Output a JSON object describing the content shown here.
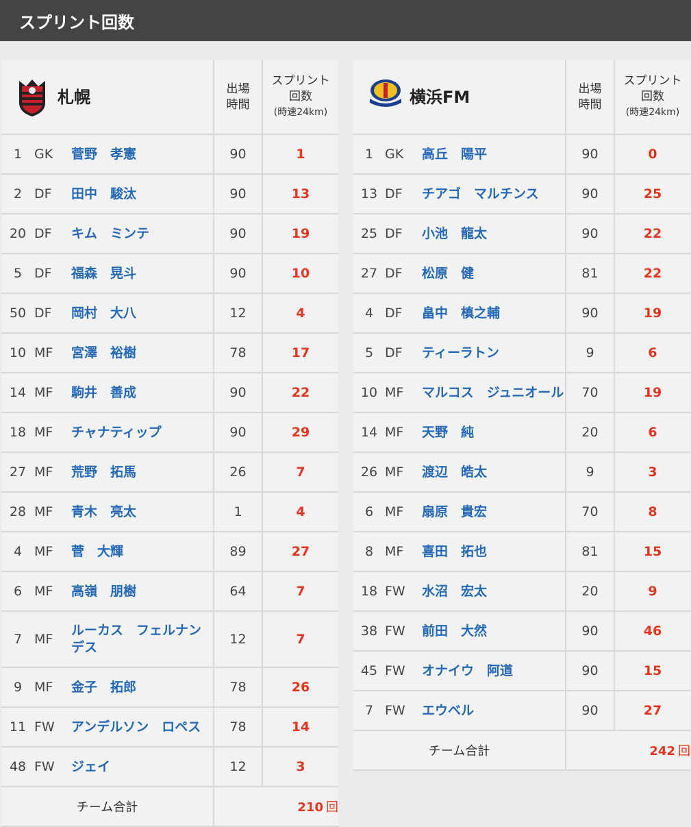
{
  "title": "スプリント回数",
  "columns": {
    "minutes_line1": "出場",
    "minutes_line2": "時間",
    "sprint_line1": "スプリント",
    "sprint_line2": "回数",
    "sprint_line3": "(時速24km)"
  },
  "total_label": "チーム合計",
  "total_unit": "回",
  "colors": {
    "header_bg": "#444444",
    "name": "#2369b8",
    "sprint": "#e8341c"
  },
  "teams": [
    {
      "name": "札幌",
      "emblem": "sapporo-emblem-icon",
      "total": "210",
      "players": [
        {
          "no": "1",
          "pos": "GK",
          "name": "菅野　孝憲",
          "min": "90",
          "sprints": "1"
        },
        {
          "no": "2",
          "pos": "DF",
          "name": "田中　駿汰",
          "min": "90",
          "sprints": "13"
        },
        {
          "no": "20",
          "pos": "DF",
          "name": "キム　ミンテ",
          "min": "90",
          "sprints": "19"
        },
        {
          "no": "5",
          "pos": "DF",
          "name": "福森　晃斗",
          "min": "90",
          "sprints": "10"
        },
        {
          "no": "50",
          "pos": "DF",
          "name": "岡村　大八",
          "min": "12",
          "sprints": "4"
        },
        {
          "no": "10",
          "pos": "MF",
          "name": "宮澤　裕樹",
          "min": "78",
          "sprints": "17"
        },
        {
          "no": "14",
          "pos": "MF",
          "name": "駒井　善成",
          "min": "90",
          "sprints": "22"
        },
        {
          "no": "18",
          "pos": "MF",
          "name": "チャナティップ",
          "min": "90",
          "sprints": "29"
        },
        {
          "no": "27",
          "pos": "MF",
          "name": "荒野　拓馬",
          "min": "26",
          "sprints": "7"
        },
        {
          "no": "28",
          "pos": "MF",
          "name": "青木　亮太",
          "min": "1",
          "sprints": "4"
        },
        {
          "no": "4",
          "pos": "MF",
          "name": "菅　大輝",
          "min": "89",
          "sprints": "27"
        },
        {
          "no": "6",
          "pos": "MF",
          "name": "高嶺　朋樹",
          "min": "64",
          "sprints": "7"
        },
        {
          "no": "7",
          "pos": "MF",
          "name": "ルーカス　フェルナンデス",
          "min": "12",
          "sprints": "7",
          "tall": true
        },
        {
          "no": "9",
          "pos": "MF",
          "name": "金子　拓郎",
          "min": "78",
          "sprints": "26"
        },
        {
          "no": "11",
          "pos": "FW",
          "name": "アンデルソン　ロペス",
          "min": "78",
          "sprints": "14"
        },
        {
          "no": "48",
          "pos": "FW",
          "name": "ジェイ",
          "min": "12",
          "sprints": "3"
        }
      ]
    },
    {
      "name": "横浜FM",
      "emblem": "yokohama-fm-emblem-icon",
      "total": "242",
      "players": [
        {
          "no": "1",
          "pos": "GK",
          "name": "高丘　陽平",
          "min": "90",
          "sprints": "0"
        },
        {
          "no": "13",
          "pos": "DF",
          "name": "チアゴ　マルチンス",
          "min": "90",
          "sprints": "25"
        },
        {
          "no": "25",
          "pos": "DF",
          "name": "小池　龍太",
          "min": "90",
          "sprints": "22"
        },
        {
          "no": "27",
          "pos": "DF",
          "name": "松原　健",
          "min": "81",
          "sprints": "22"
        },
        {
          "no": "4",
          "pos": "DF",
          "name": "畠中　槙之輔",
          "min": "90",
          "sprints": "19"
        },
        {
          "no": "5",
          "pos": "DF",
          "name": "ティーラトン",
          "min": "9",
          "sprints": "6"
        },
        {
          "no": "10",
          "pos": "MF",
          "name": "マルコス　ジュニオール",
          "min": "70",
          "sprints": "19"
        },
        {
          "no": "14",
          "pos": "MF",
          "name": "天野　純",
          "min": "20",
          "sprints": "6"
        },
        {
          "no": "26",
          "pos": "MF",
          "name": "渡辺　皓太",
          "min": "9",
          "sprints": "3"
        },
        {
          "no": "6",
          "pos": "MF",
          "name": "扇原　貴宏",
          "min": "70",
          "sprints": "8"
        },
        {
          "no": "8",
          "pos": "MF",
          "name": "喜田　拓也",
          "min": "81",
          "sprints": "15"
        },
        {
          "no": "18",
          "pos": "FW",
          "name": "水沼　宏太",
          "min": "20",
          "sprints": "9"
        },
        {
          "no": "38",
          "pos": "FW",
          "name": "前田　大然",
          "min": "90",
          "sprints": "46"
        },
        {
          "no": "45",
          "pos": "FW",
          "name": "オナイウ　阿道",
          "min": "90",
          "sprints": "15"
        },
        {
          "no": "7",
          "pos": "FW",
          "name": "エウベル",
          "min": "90",
          "sprints": "27"
        }
      ]
    }
  ]
}
